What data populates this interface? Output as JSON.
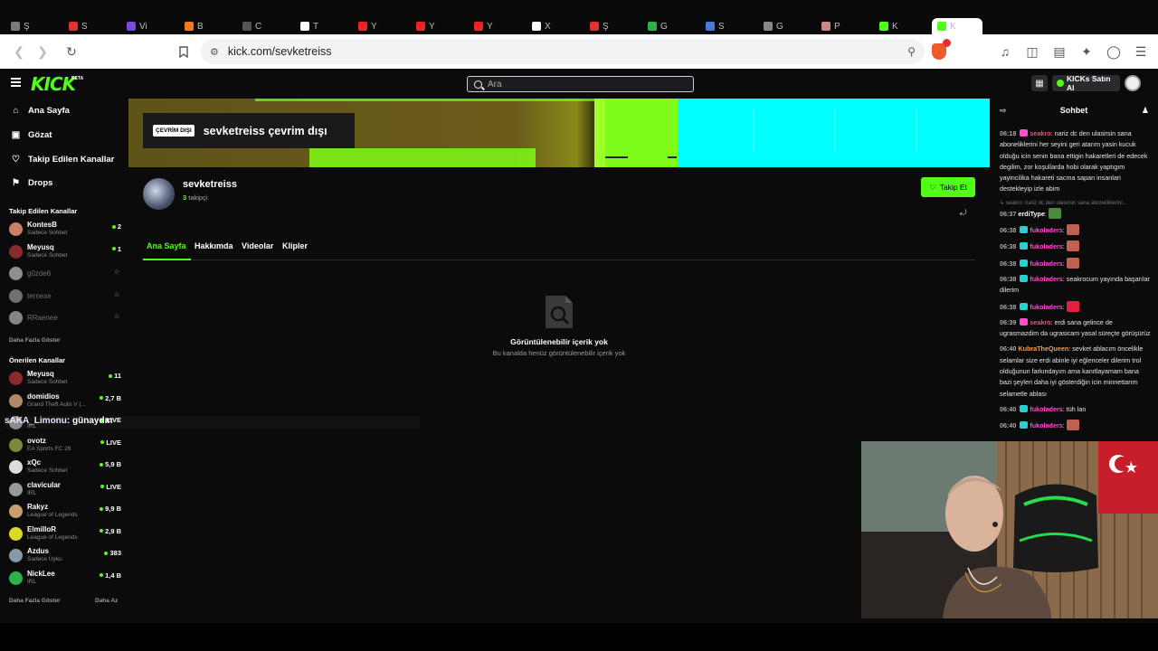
{
  "browser": {
    "tabs": [
      {
        "label": "Ş",
        "color": "#7a7a7a"
      },
      {
        "label": "S",
        "color": "#d33"
      },
      {
        "label": "Vi",
        "color": "#7b4ad6"
      },
      {
        "label": "B",
        "color": "#f07a20"
      },
      {
        "label": "C",
        "color": "#555"
      },
      {
        "label": "T",
        "color": "#fff"
      },
      {
        "label": "Y",
        "color": "#e22"
      },
      {
        "label": "Y",
        "color": "#e22"
      },
      {
        "label": "Y",
        "color": "#e22"
      },
      {
        "label": "X",
        "color": "#fff"
      },
      {
        "label": "Ş",
        "color": "#d33"
      },
      {
        "label": "G",
        "color": "#2bb34a"
      },
      {
        "label": "S",
        "color": "#4a7ad6"
      },
      {
        "label": "G",
        "color": "#888"
      },
      {
        "label": "P",
        "color": "#c88"
      },
      {
        "label": "K",
        "color": "#53fc18"
      },
      {
        "label": "K",
        "color": "#53fc18"
      }
    ],
    "url": "kick.com/sevketreiss"
  },
  "topbar": {
    "logo": "KICK",
    "logo_beta": "BETA",
    "search_placeholder": "Ara",
    "kicks_label": "KICKs Satın Al"
  },
  "sidebar": {
    "nav": [
      {
        "label": "Ana Sayfa",
        "icon": "home-icon"
      },
      {
        "label": "Gözat",
        "icon": "browse-icon"
      },
      {
        "label": "Takip Edilen Kanallar",
        "icon": "heart-icon"
      },
      {
        "label": "Drops",
        "icon": "drops-icon"
      }
    ],
    "followed_title": "Takip Edilen Kanallar",
    "followed": [
      {
        "name": "KontesB",
        "sub": "Sadece Sohbet",
        "count": "2",
        "color": "#c9806a"
      },
      {
        "name": "Meyusq",
        "sub": "Sadece Sohbet",
        "count": "1",
        "color": "#8a2a2a"
      },
      {
        "name": "g0zde6",
        "sub": "",
        "count": "",
        "color": "#eee"
      },
      {
        "name": "ternexe",
        "sub": "",
        "count": "",
        "color": "#bbb"
      },
      {
        "name": "RRaenee",
        "sub": "",
        "count": "",
        "color": "#ddd"
      }
    ],
    "more1": "Daha Fazla Göster",
    "recommended_title": "Önerilen Kanallar",
    "recommended": [
      {
        "name": "Meyusq",
        "sub": "Sadece Sohbet",
        "count": "11",
        "color": "#8a2a2a"
      },
      {
        "name": "domidios",
        "sub": "Grand Theft Auto V (...",
        "count": "2,7 B",
        "color": "#b08868"
      },
      {
        "name": "",
        "sub": "IRL",
        "count": "LIVE",
        "color": "#888"
      },
      {
        "name": "ovotz",
        "sub": "EA Sports FC 26",
        "count": "LIVE",
        "color": "#7a8a3a"
      },
      {
        "name": "xQc",
        "sub": "Sadece Sohbet",
        "count": "5,9 B",
        "color": "#ddd"
      },
      {
        "name": "clavicular",
        "sub": "IRL",
        "count": "LIVE",
        "color": "#999"
      },
      {
        "name": "Rakyz",
        "sub": "League of Legends",
        "count": "9,9 B",
        "color": "#c8a070"
      },
      {
        "name": "ElmilloR",
        "sub": "League of Legends",
        "count": "2,9 B",
        "color": "#d9d92a"
      },
      {
        "name": "Azdus",
        "sub": "Sadece Uyku",
        "count": "383",
        "color": "#8899aa"
      },
      {
        "name": "NickLee",
        "sub": "IRL",
        "count": "1,4 B",
        "color": "#2bb34a"
      }
    ],
    "more2": "Daha Fazla Göster",
    "less": "Daha Az"
  },
  "overlay": {
    "user": "sAKA_Limonu",
    "text": ": günaydın"
  },
  "channel": {
    "offline_badge": "ÇEVRİM DIŞI",
    "offline_title": "sevketreiss çevrim dışı",
    "name": "sevketreiss",
    "followers_count": "3",
    "followers_label": "takipçi",
    "follow_label": "Takip Et",
    "tabs": [
      "Ana Sayfa",
      "Hakkımda",
      "Videolar",
      "Klipler"
    ],
    "empty_title": "Görüntülenebilir içerik yok",
    "empty_sub": "Bu kanalda henüz görüntülenebilir içerik yok"
  },
  "chat": {
    "title": "Sohbet",
    "messages": [
      {
        "time": "06:18",
        "user": "seakro",
        "ucolor": "#ff4d6d",
        "badge": "#ff4dd2",
        "text": ": nariz dc den ulasirsin sana aboneliklerini her seyini geri atarım yasin kucuk olduğu icin senin bana ettigin hakaretleri de edecek degilim, zor koşullarda hobi olarak yaptıgım yayincilika hakareti sacma sapan insanlari destekleyip izle abim"
      },
      {
        "reply": "↳ seakro: nariz dc den ulasirsin sana aboneliklerini..."
      },
      {
        "time": "06:37",
        "user": "erdiType",
        "ucolor": "#ffffff",
        "badge": "",
        "text": ":",
        "emote": "#4a8a3a"
      },
      {
        "time": "06:38",
        "user": "fukoladers",
        "ucolor": "#ff4dd2",
        "badge": "#2ad0d0",
        "text": ":",
        "emote": "#c06050"
      },
      {
        "time": "06:38",
        "user": "fukoladers",
        "ucolor": "#ff4dd2",
        "badge": "#2ad0d0",
        "text": ":",
        "emote": "#c06050"
      },
      {
        "time": "06:38",
        "user": "fukoladers",
        "ucolor": "#ff4dd2",
        "badge": "#2ad0d0",
        "text": ":",
        "emote": "#c06050"
      },
      {
        "time": "06:38",
        "user": "fukoladers",
        "ucolor": "#ff4dd2",
        "badge": "#2ad0d0",
        "text": ": seakrocum yayında başarılar dilerim"
      },
      {
        "time": "06:38",
        "user": "fukoladers",
        "ucolor": "#ff4dd2",
        "badge": "#2ad0d0",
        "text": ":",
        "emote": "#e02040"
      },
      {
        "time": "06:39",
        "user": "seakro",
        "ucolor": "#ff4d6d",
        "badge": "#ff4dd2",
        "text": ": erdi sana gelince de ugrasmazdim da ugrasicam yasal süreçte görüşürüz"
      },
      {
        "time": "06:40",
        "user": "KubraTheQueen",
        "ucolor": "#ff9a3d",
        "badge": "",
        "text": ": sevket ablacım öncelikle selamlar size erdi abinle iyi eğlenceler dilerim trol olduğunun farkındayım ama kanıtlayamam bana bazi şeyleri daha iyi gösterdiğin icin minnettarım selametle ablası"
      },
      {
        "time": "06:40",
        "user": "fukoladers",
        "ucolor": "#ff4dd2",
        "badge": "#2ad0d0",
        "text": ": tüh lan"
      },
      {
        "time": "06:40",
        "user": "fukoladers",
        "ucolor": "#ff4dd2",
        "badge": "#2ad0d0",
        "text": ":",
        "emote": "#c06050"
      }
    ]
  },
  "colors": {
    "accent": "#53fc18",
    "banner_cyan": "#00ffff",
    "banner_olive": "#6b5a1a"
  }
}
